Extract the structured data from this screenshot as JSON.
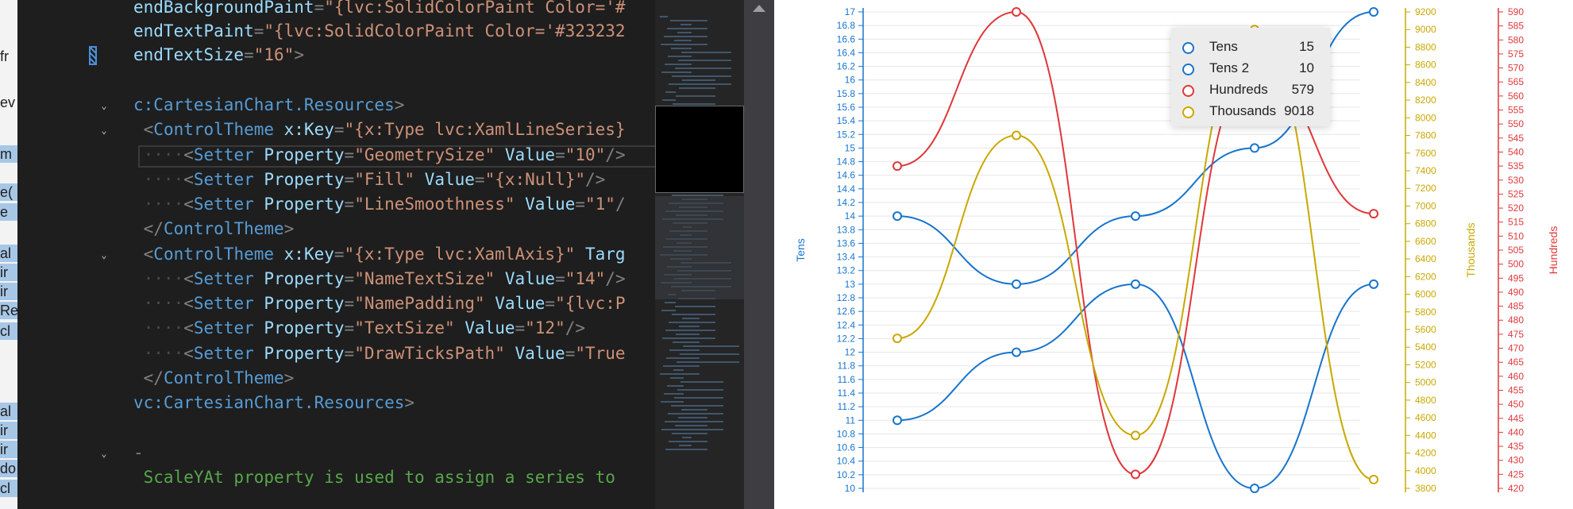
{
  "left_panel": {
    "items": [
      {
        "text": "fr",
        "top": 60,
        "sel": false
      },
      {
        "text": "ev",
        "top": 118,
        "sel": false
      },
      {
        "text": "m",
        "top": 183,
        "sel": true
      },
      {
        "text": "e(",
        "top": 231,
        "sel": true
      },
      {
        "text": "e",
        "top": 256,
        "sel": true
      },
      {
        "text": "al",
        "top": 308,
        "sel": true
      },
      {
        "text": "ir",
        "top": 332,
        "sel": true
      },
      {
        "text": "ir",
        "top": 356,
        "sel": true
      },
      {
        "text": "Re",
        "top": 380,
        "sel": true
      },
      {
        "text": "cl",
        "top": 406,
        "sel": true
      },
      {
        "text": "al",
        "top": 507,
        "sel": true
      },
      {
        "text": "ir",
        "top": 531,
        "sel": true
      },
      {
        "text": "ir",
        "top": 555,
        "sel": true
      },
      {
        "text": "do",
        "top": 579,
        "sel": true
      },
      {
        "text": "cl",
        "top": 604,
        "sel": true
      }
    ]
  },
  "editor": {
    "lines": [
      {
        "top": -6,
        "fold": false,
        "tokens": [
          [
            "attr",
            "endBackgroundPaint"
          ],
          [
            "pun",
            "="
          ],
          [
            "str",
            "\"{lvc:SolidColorPaint Color='#"
          ]
        ]
      },
      {
        "top": 24,
        "fold": false,
        "tokens": [
          [
            "attr",
            "endTextPaint"
          ],
          [
            "pun",
            "="
          ],
          [
            "str",
            "\"{lvc:SolidColorPaint Color='#323232"
          ]
        ]
      },
      {
        "top": 54,
        "fold": false,
        "tokens": [
          [
            "attr",
            "endTextSize"
          ],
          [
            "pun",
            "="
          ],
          [
            "str",
            "\"16\""
          ],
          [
            "pun",
            ">"
          ]
        ]
      },
      {
        "top": 117,
        "fold": true,
        "tokens": [
          [
            "el",
            "c:CartesianChart.Resources"
          ],
          [
            "pun",
            ">"
          ]
        ]
      },
      {
        "top": 148,
        "fold": true,
        "tokens": [
          [
            "pun",
            " <"
          ],
          [
            "el",
            "ControlTheme"
          ],
          [
            "attr",
            " x:Key"
          ],
          [
            "pun",
            "="
          ],
          [
            "str",
            "\"{x:Type lvc:XamlLineSeries}"
          ]
        ]
      },
      {
        "top": 180,
        "fold": false,
        "tokens": [
          [
            "dot",
            " ····"
          ],
          [
            "pun",
            "<"
          ],
          [
            "el",
            "Setter"
          ],
          [
            "attr",
            " Property"
          ],
          [
            "pun",
            "="
          ],
          [
            "str",
            "\"GeometrySize\""
          ],
          [
            "attr",
            " Value"
          ],
          [
            "pun",
            "="
          ],
          [
            "str",
            "\"10\""
          ],
          [
            "pun",
            "/>"
          ]
        ]
      },
      {
        "top": 211,
        "fold": false,
        "tokens": [
          [
            "dot",
            " ····"
          ],
          [
            "pun",
            "<"
          ],
          [
            "el",
            "Setter"
          ],
          [
            "attr",
            " Property"
          ],
          [
            "pun",
            "="
          ],
          [
            "str",
            "\"Fill\""
          ],
          [
            "attr",
            " Value"
          ],
          [
            "pun",
            "="
          ],
          [
            "str",
            "\"{x:Null}\""
          ],
          [
            "pun",
            "/>"
          ]
        ]
      },
      {
        "top": 242,
        "fold": false,
        "tokens": [
          [
            "dot",
            " ····"
          ],
          [
            "pun",
            "<"
          ],
          [
            "el",
            "Setter"
          ],
          [
            "attr",
            " Property"
          ],
          [
            "pun",
            "="
          ],
          [
            "str",
            "\"LineSmoothness\""
          ],
          [
            "attr",
            " Value"
          ],
          [
            "pun",
            "="
          ],
          [
            "str",
            "\"1\""
          ],
          [
            "pun",
            "/"
          ]
        ]
      },
      {
        "top": 273,
        "fold": false,
        "tokens": [
          [
            "pun",
            " </"
          ],
          [
            "el",
            "ControlTheme"
          ],
          [
            "pun",
            ">"
          ]
        ]
      },
      {
        "top": 305,
        "fold": true,
        "tokens": [
          [
            "pun",
            " <"
          ],
          [
            "el",
            "ControlTheme"
          ],
          [
            "attr",
            " x:Key"
          ],
          [
            "pun",
            "="
          ],
          [
            "str",
            "\"{x:Type lvc:XamlAxis}\""
          ],
          [
            "attr",
            " Targ"
          ]
        ]
      },
      {
        "top": 336,
        "fold": false,
        "tokens": [
          [
            "dot",
            " ····"
          ],
          [
            "pun",
            "<"
          ],
          [
            "el",
            "Setter"
          ],
          [
            "attr",
            " Property"
          ],
          [
            "pun",
            "="
          ],
          [
            "str",
            "\"NameTextSize\""
          ],
          [
            "attr",
            " Value"
          ],
          [
            "pun",
            "="
          ],
          [
            "str",
            "\"14\""
          ],
          [
            "pun",
            "/>"
          ]
        ]
      },
      {
        "top": 367,
        "fold": false,
        "tokens": [
          [
            "dot",
            " ····"
          ],
          [
            "pun",
            "<"
          ],
          [
            "el",
            "Setter"
          ],
          [
            "attr",
            " Property"
          ],
          [
            "pun",
            "="
          ],
          [
            "str",
            "\"NamePadding\""
          ],
          [
            "attr",
            " Value"
          ],
          [
            "pun",
            "="
          ],
          [
            "str",
            "\"{lvc:P"
          ]
        ]
      },
      {
        "top": 398,
        "fold": false,
        "tokens": [
          [
            "dot",
            " ····"
          ],
          [
            "pun",
            "<"
          ],
          [
            "el",
            "Setter"
          ],
          [
            "attr",
            " Property"
          ],
          [
            "pun",
            "="
          ],
          [
            "str",
            "\"TextSize\""
          ],
          [
            "attr",
            " Value"
          ],
          [
            "pun",
            "="
          ],
          [
            "str",
            "\"12\""
          ],
          [
            "pun",
            "/>"
          ]
        ]
      },
      {
        "top": 430,
        "fold": false,
        "tokens": [
          [
            "dot",
            " ····"
          ],
          [
            "pun",
            "<"
          ],
          [
            "el",
            "Setter"
          ],
          [
            "attr",
            " Property"
          ],
          [
            "pun",
            "="
          ],
          [
            "str",
            "\"DrawTicksPath\""
          ],
          [
            "attr",
            " Value"
          ],
          [
            "pun",
            "="
          ],
          [
            "str",
            "\"True"
          ]
        ]
      },
      {
        "top": 461,
        "fold": false,
        "tokens": [
          [
            "pun",
            " </"
          ],
          [
            "el",
            "ControlTheme"
          ],
          [
            "pun",
            ">"
          ]
        ]
      },
      {
        "top": 492,
        "fold": false,
        "tokens": [
          [
            "el",
            "vc:CartesianChart.Resources"
          ],
          [
            "pun",
            ">"
          ]
        ]
      },
      {
        "top": 555,
        "fold": true,
        "tokens": [
          [
            "pun",
            "-"
          ]
        ]
      },
      {
        "top": 586,
        "fold": false,
        "tokens": [
          [
            "cm",
            " ScaleYAt property is used to assign a series to"
          ]
        ]
      }
    ]
  },
  "chart_data": {
    "type": "line",
    "x": [
      0,
      1,
      2,
      3,
      4
    ],
    "axes": {
      "tens": {
        "name": "Tens",
        "min": 10,
        "max": 17,
        "step": 0.2,
        "color": "#1874cd"
      },
      "thousands": {
        "name": "Thousands",
        "min": 3800,
        "max": 9200,
        "step": 200,
        "color": "#c9a800"
      },
      "hundreds": {
        "name": "Hundreds",
        "min": 420,
        "max": 590,
        "step": 5,
        "color": "#e0373b"
      }
    },
    "series": [
      {
        "name": "Tens",
        "axis": "tens",
        "color": "#1874cd",
        "values": [
          14,
          13,
          14,
          15,
          17
        ]
      },
      {
        "name": "Tens 2",
        "axis": "tens",
        "color": "#1874cd",
        "values": [
          11,
          12,
          13,
          10,
          13
        ]
      },
      {
        "name": "Hundreds",
        "axis": "hundreds",
        "color": "#e0373b",
        "values": [
          535,
          590,
          425,
          570,
          518
        ]
      },
      {
        "name": "Thousands",
        "axis": "thousands",
        "color": "#c9a800",
        "values": [
          5500,
          7800,
          4400,
          9000,
          3900
        ]
      }
    ],
    "grid": true,
    "tooltip": {
      "rows": [
        {
          "name": "Tens",
          "value": "15",
          "color": "#1874cd"
        },
        {
          "name": "Tens 2",
          "value": "10",
          "color": "#1874cd"
        },
        {
          "name": "Hundreds",
          "value": "579",
          "color": "#e0373b"
        },
        {
          "name": "Thousands",
          "value": "9018",
          "color": "#c9a800"
        }
      ]
    }
  }
}
